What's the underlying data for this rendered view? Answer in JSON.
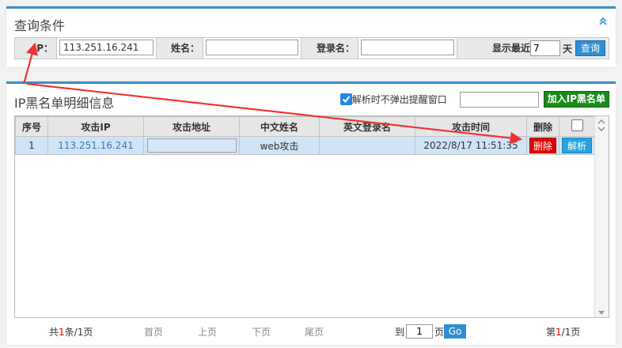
{
  "query_panel": {
    "title": "查询条件",
    "ip_label": "IP：",
    "ip_value": "113.251.16.241",
    "name_label": "姓名：",
    "name_value": "",
    "login_label": "登录名：",
    "login_value": "",
    "recent_label": "显示最近",
    "days_value": "7",
    "days_unit": "天",
    "query_button": "查询"
  },
  "list_panel": {
    "title": "IP黑名单明细信息",
    "no_popup_label": "解析时不弹出提醒窗口",
    "no_popup_checked": true,
    "add_ip_value": "",
    "add_button": "加入IP黑名单",
    "columns": [
      "序号",
      "攻击IP",
      "攻击地址",
      "中文姓名",
      "英文登录名",
      "攻击时间",
      "删除"
    ],
    "rows": [
      {
        "index": "1",
        "ip": "113.251.16.241",
        "address": "",
        "cn_name": "web攻击",
        "en_login": "",
        "time": "2022/8/17 11:51:35",
        "delete_label": "删除",
        "parse_label": "解析"
      }
    ],
    "pager": {
      "total_prefix": "共",
      "total_count": "1",
      "total_mid": "条/",
      "total_pages": "1",
      "total_suffix": "页",
      "first": "首页",
      "prev": "上页",
      "next": "下页",
      "last": "尾页",
      "goto_prefix": "到",
      "goto_value": "1",
      "goto_suffix": "页",
      "go_button": "Go",
      "current_prefix": "第",
      "current_page": "1",
      "current_mid": "/",
      "current_total": "1",
      "current_suffix": "页"
    }
  },
  "annotations": {
    "arrow_color": "#ee3333",
    "arrows": [
      "ip-field-to-ip-label",
      "ip-label-to-delete-button"
    ]
  }
}
